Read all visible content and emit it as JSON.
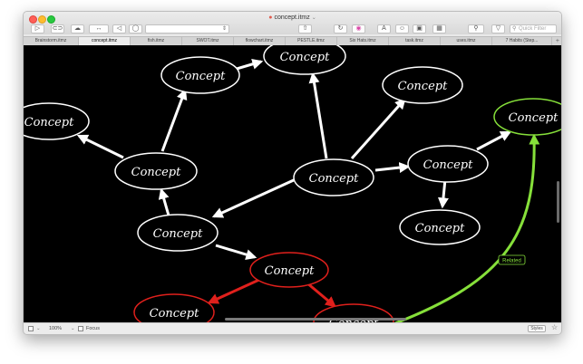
{
  "window": {
    "title": "concept.itmz",
    "title_chevron": "⌄"
  },
  "toolbar": {
    "search_placeholder": "Quick Filter"
  },
  "tabs": [
    {
      "label": "Brainstorm.itmz",
      "active": false
    },
    {
      "label": "concept.itmz",
      "active": true
    },
    {
      "label": "fish.itmz",
      "active": false
    },
    {
      "label": "SWOT.itmz",
      "active": false
    },
    {
      "label": "flowchart.itmz",
      "active": false
    },
    {
      "label": "PESTLE.itmz",
      "active": false
    },
    {
      "label": "Six Hats.itmz",
      "active": false
    },
    {
      "label": "task.itmz",
      "active": false
    },
    {
      "label": "uses.itmz",
      "active": false
    },
    {
      "label": "7 Habits (Step...",
      "active": false
    }
  ],
  "map": {
    "node_label": "Concept",
    "relation_label": "Related",
    "colors": {
      "background": "#000000",
      "default": "#ffffff",
      "red": "#e0201c",
      "green": "#86e03a"
    }
  },
  "statusbar": {
    "zoom": "100%",
    "focus_label": "Focus",
    "styles_label": "Styles"
  }
}
